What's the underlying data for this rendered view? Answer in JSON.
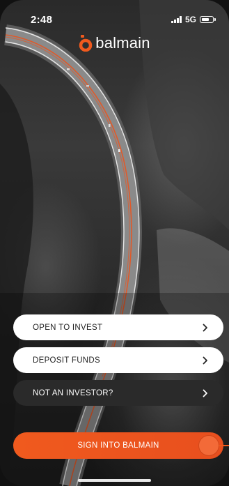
{
  "status_bar": {
    "time": "2:48",
    "network": "5G"
  },
  "brand": {
    "name": "balmain",
    "accent_color": "#f05a1e"
  },
  "menu": {
    "items": [
      {
        "label": "OPEN TO INVEST",
        "style": "light"
      },
      {
        "label": "DEPOSIT FUNDS",
        "style": "light"
      },
      {
        "label": "NOT AN INVESTOR?",
        "style": "dark"
      }
    ]
  },
  "signin": {
    "label": "SIGN INTO BALMAIN"
  },
  "icons": {
    "signal": "signal-bars-icon",
    "battery": "battery-icon",
    "chevron": "chevron-right-icon",
    "logo": "balmain-logo-icon"
  }
}
